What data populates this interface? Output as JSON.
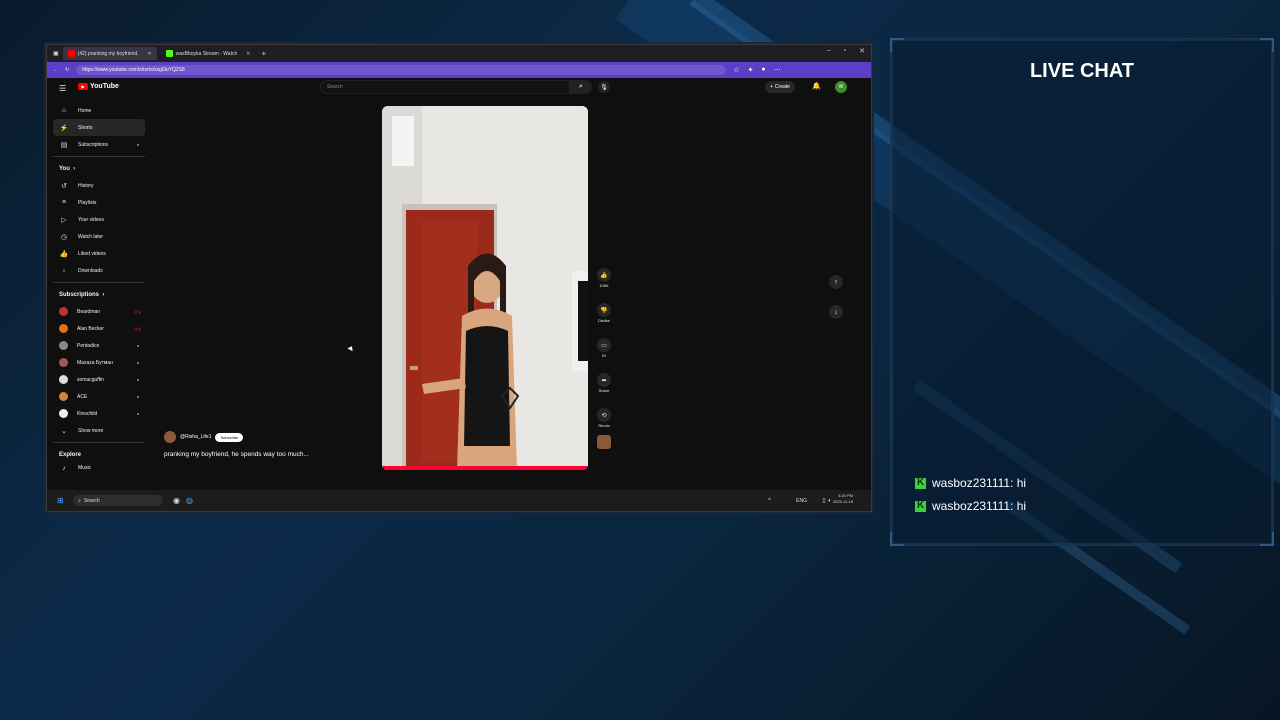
{
  "browser": {
    "tabs": [
      {
        "label": "(42) pranking my boyfriend.",
        "active": true
      },
      {
        "label": "wasBboyka Stream - Watch",
        "active": false
      }
    ],
    "url": "https://www.youtube.com/shorts/xxgl3uYQ2S8"
  },
  "youtube": {
    "logo": "YouTube",
    "search_placeholder": "Search",
    "create_label": "Create",
    "notifications": "9+",
    "avatar_letter": "W",
    "sidebar": {
      "main": [
        {
          "label": "Home",
          "icon": "home-icon"
        },
        {
          "label": "Shorts",
          "icon": "shorts-icon",
          "selected": true
        },
        {
          "label": "Subscriptions",
          "icon": "subscriptions-icon"
        }
      ],
      "you_header": "You",
      "you": [
        {
          "label": "History"
        },
        {
          "label": "Playlists"
        },
        {
          "label": "Your videos"
        },
        {
          "label": "Watch later"
        },
        {
          "label": "Liked videos"
        },
        {
          "label": "Downloads"
        }
      ],
      "subs_header": "Subscriptions",
      "subscriptions": [
        {
          "label": "Beardman",
          "live": true
        },
        {
          "label": "Alan Becker",
          "live": true
        },
        {
          "label": "Pentadice"
        },
        {
          "label": "Maxaza Бутман"
        },
        {
          "label": "somacguffin"
        },
        {
          "label": "ACE"
        },
        {
          "label": "Kinochild"
        }
      ],
      "show_more": "Show more",
      "explore_header": "Explore",
      "explore": [
        {
          "label": "Music"
        }
      ]
    },
    "short": {
      "author": "@Risha_Life1",
      "subscribe": "Subscribe",
      "caption": "pranking my boyfriend, he spends way too much...",
      "likes": "106K",
      "dislike": "Dislike",
      "comments": "91",
      "share": "Share",
      "remix": "Remix"
    }
  },
  "taskbar": {
    "search": "Search",
    "lang": "ENG",
    "time": "4:20 PM",
    "date": "2025-11-15"
  },
  "chat": {
    "title": "LIVE CHAT",
    "messages": [
      {
        "user": "wasboz231111",
        "text": "hi"
      },
      {
        "user": "wasboz231111",
        "text": "hi"
      }
    ]
  }
}
